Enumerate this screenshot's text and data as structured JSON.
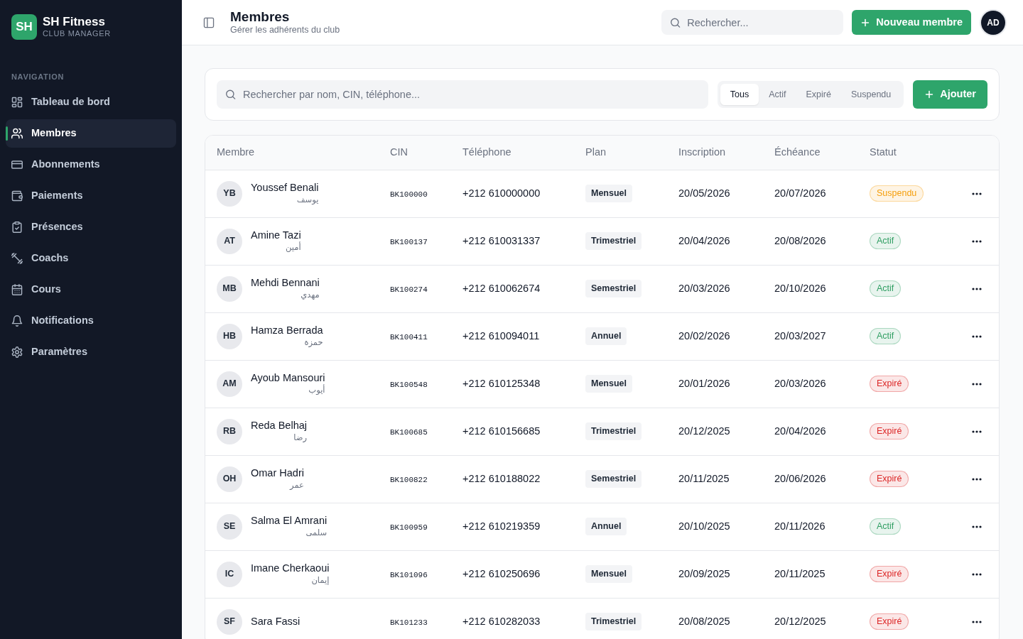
{
  "sidebar": {
    "logo": "SH",
    "brand": "SH Fitness",
    "tagline": "CLUB MANAGER",
    "section_label": "NAVIGATION",
    "items": [
      {
        "label": "Tableau de bord",
        "selected": false
      },
      {
        "label": "Membres",
        "selected": true
      },
      {
        "label": "Abonnements",
        "selected": false
      },
      {
        "label": "Paiements",
        "selected": false
      },
      {
        "label": "Présences",
        "selected": false
      },
      {
        "label": "Coachs",
        "selected": false
      },
      {
        "label": "Cours",
        "selected": false
      },
      {
        "label": "Notifications",
        "selected": false
      },
      {
        "label": "Paramètres",
        "selected": false
      }
    ]
  },
  "header": {
    "title": "Membres",
    "subtitle": "Gérer les adhérents du club",
    "search": {
      "placeholder": "Rechercher..."
    },
    "new_button": "Nouveau membre",
    "avatar": "AD"
  },
  "filters": {
    "search": {
      "placeholder": "Rechercher par nom, CIN, téléphone..."
    },
    "tabs": [
      {
        "label": "Tous",
        "selected": true
      },
      {
        "label": "Actif",
        "selected": false
      },
      {
        "label": "Expiré",
        "selected": false
      },
      {
        "label": "Suspendu",
        "selected": false
      }
    ],
    "add_button": "Ajouter"
  },
  "table": {
    "columns": [
      "Membre",
      "CIN",
      "Téléphone",
      "Plan",
      "Inscription",
      "Échéance",
      "Statut"
    ],
    "rows": [
      {
        "initials": "YB",
        "name": "Youssef Benali",
        "name_ar": "يوسف",
        "cin": "BK100000",
        "phone": "+212 610000000",
        "plan": "Mensuel",
        "inscription": "20/05/2026",
        "echeance": "20/07/2026",
        "status": "Suspendu",
        "color": "#f59e0b"
      },
      {
        "initials": "AT",
        "name": "Amine Tazi",
        "name_ar": "أمين",
        "cin": "BK100137",
        "phone": "+212 610031337",
        "plan": "Trimestriel",
        "inscription": "20/04/2026",
        "echeance": "20/08/2026",
        "status": "Actif",
        "color": "#2f9e62"
      },
      {
        "initials": "MB",
        "name": "Mehdi Bennani",
        "name_ar": "مهدي",
        "cin": "BK100274",
        "phone": "+212 610062674",
        "plan": "Semestriel",
        "inscription": "20/03/2026",
        "echeance": "20/10/2026",
        "status": "Actif",
        "color": "#2f9e62"
      },
      {
        "initials": "HB",
        "name": "Hamza Berrada",
        "name_ar": "حمزة",
        "cin": "BK100411",
        "phone": "+212 610094011",
        "plan": "Annuel",
        "inscription": "20/02/2026",
        "echeance": "20/03/2027",
        "status": "Actif",
        "color": "#2f9e62"
      },
      {
        "initials": "AM",
        "name": "Ayoub Mansouri",
        "name_ar": "أيوب",
        "cin": "BK100548",
        "phone": "+212 610125348",
        "plan": "Mensuel",
        "inscription": "20/01/2026",
        "echeance": "20/03/2026",
        "status": "Expiré",
        "color": "#dc2626"
      },
      {
        "initials": "RB",
        "name": "Reda Belhaj",
        "name_ar": "رضا",
        "cin": "BK100685",
        "phone": "+212 610156685",
        "plan": "Trimestriel",
        "inscription": "20/12/2025",
        "echeance": "20/04/2026",
        "status": "Expiré",
        "color": "#dc2626"
      },
      {
        "initials": "OH",
        "name": "Omar Hadri",
        "name_ar": "عمر",
        "cin": "BK100822",
        "phone": "+212 610188022",
        "plan": "Semestriel",
        "inscription": "20/11/2025",
        "echeance": "20/06/2026",
        "status": "Expiré",
        "color": "#dc2626"
      },
      {
        "initials": "SE",
        "name": "Salma El Amrani",
        "name_ar": "سلمى",
        "cin": "BK100959",
        "phone": "+212 610219359",
        "plan": "Annuel",
        "inscription": "20/10/2025",
        "echeance": "20/11/2026",
        "status": "Actif",
        "color": "#2f9e62"
      },
      {
        "initials": "IC",
        "name": "Imane Cherkaoui",
        "name_ar": "إيمان",
        "cin": "BK101096",
        "phone": "+212 610250696",
        "plan": "Mensuel",
        "inscription": "20/09/2025",
        "echeance": "20/11/2025",
        "status": "Expiré",
        "color": "#dc2626"
      },
      {
        "initials": "SF",
        "name": "Sara Fassi",
        "cin": "BK101233",
        "phone": "+212 610282033",
        "plan": "Trimestriel",
        "inscription": "20/08/2025",
        "echeance": "20/12/2025",
        "status": "Expiré",
        "color": "#dc2626"
      }
    ]
  }
}
